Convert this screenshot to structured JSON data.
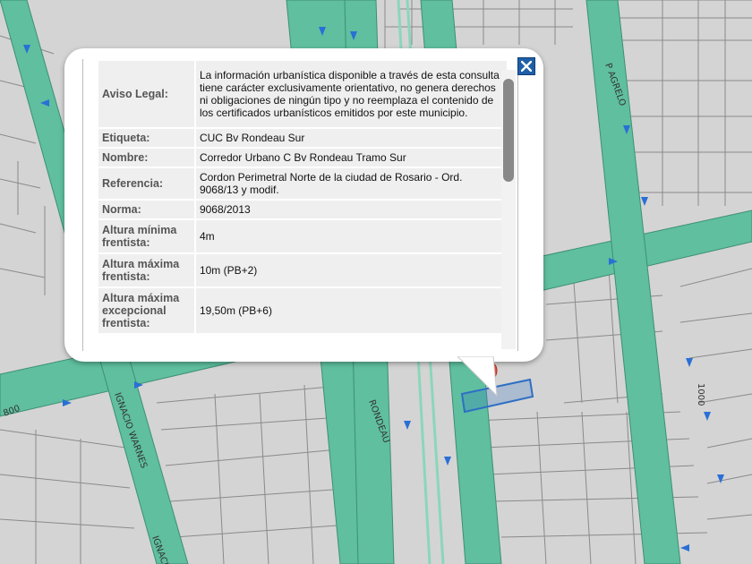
{
  "map": {
    "street_labels": [
      "P AGRELO",
      "IGNACIO WARNES",
      "RONDEAU",
      "IGNACIO",
      "800",
      "1000"
    ],
    "colors": {
      "street": "#5fbf9f",
      "block": "#d4d4d4",
      "parcel_line": "#8a8a8a",
      "arrow": "#2a6fd6",
      "highlight": "#2e6fc4"
    }
  },
  "popup": {
    "close_icon": "close-icon",
    "rows": [
      {
        "label": "Aviso Legal:",
        "value": "La información urbanística disponible a través de esta consulta tiene carácter exclusivamente orientativo, no genera derechos ni obligaciones de ningún tipo y no reemplaza el contenido de los certificados urbanísticos emitidos por este municipio."
      },
      {
        "label": "Etiqueta:",
        "value": "CUC Bv Rondeau Sur"
      },
      {
        "label": "Nombre:",
        "value": "Corredor Urbano C Bv Rondeau Tramo Sur"
      },
      {
        "label": "Referencia:",
        "value": "Cordon Perimetral Norte de la ciudad de Rosario - Ord. 9068/13 y modif."
      },
      {
        "label": "Norma:",
        "value": "9068/2013"
      },
      {
        "label": "Altura mínima frentista:",
        "value": "4m"
      },
      {
        "label": "Altura máxima frentista:",
        "value": "10m (PB+2)"
      },
      {
        "label": "Altura máxima excepcional frentista:",
        "value": "19,50m (PB+6)"
      }
    ]
  }
}
